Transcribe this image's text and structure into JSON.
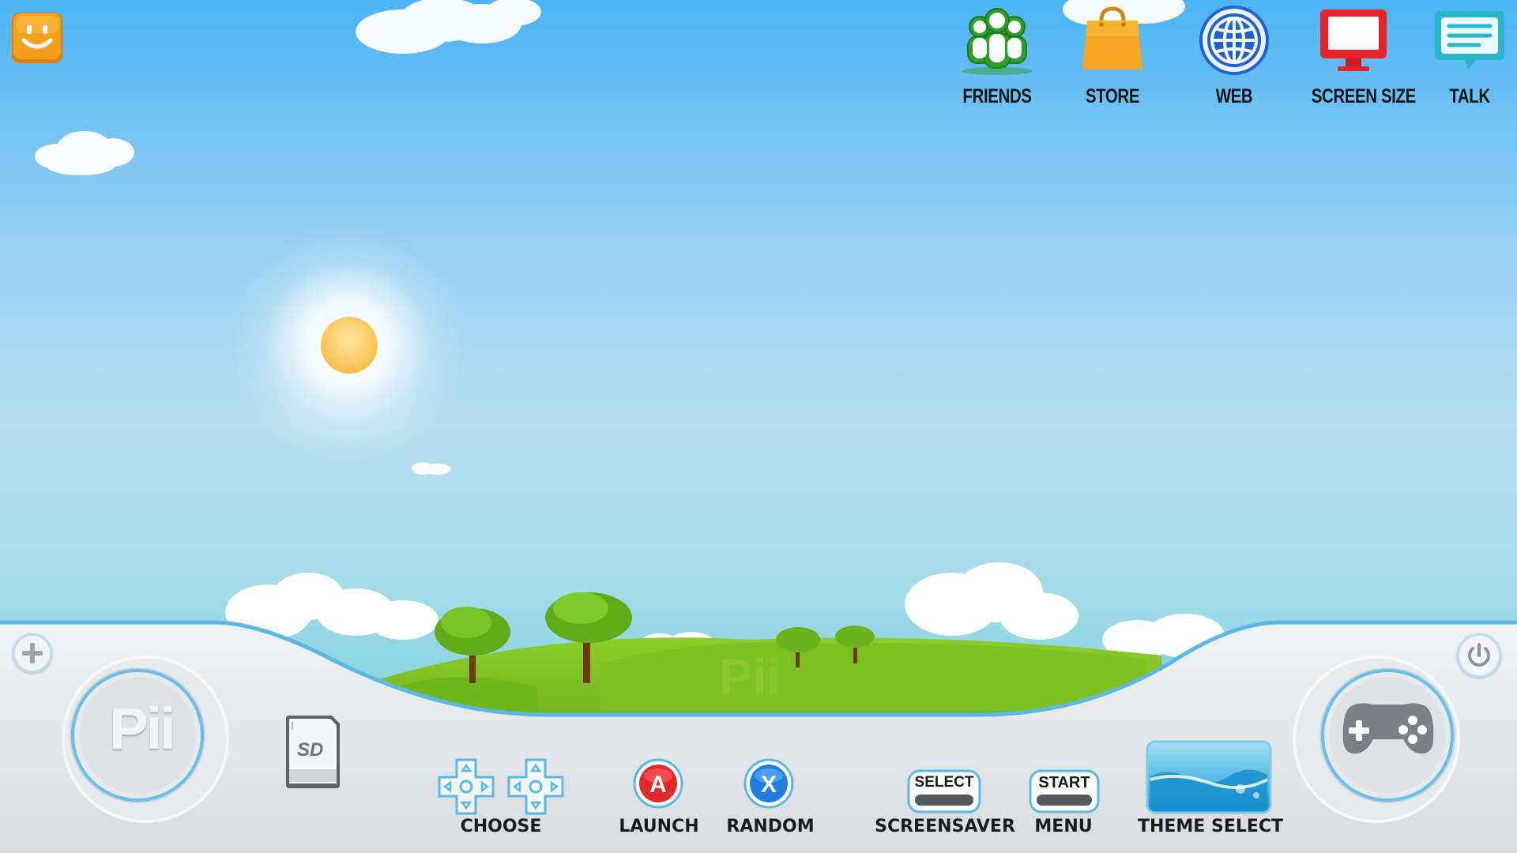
{
  "top_apps": [
    {
      "label": "FRIENDS",
      "icon": "friends-icon"
    },
    {
      "label": "STORE",
      "icon": "shopping-bag-icon"
    },
    {
      "label": "WEB",
      "icon": "globe-icon"
    },
    {
      "label": "SCREEN SIZE",
      "icon": "monitor-icon"
    },
    {
      "label": "TALK",
      "icon": "chat-bubble-icon"
    }
  ],
  "dock": {
    "logo_text": "Pii",
    "watermark_text": "Pii",
    "sd_card_text": "SD",
    "controls": [
      {
        "label": "CHOOSE",
        "glyph": "D-pad"
      },
      {
        "label": "LAUNCH",
        "glyph": "A"
      },
      {
        "label": "RANDOM",
        "glyph": "X"
      },
      {
        "label": "SCREENSAVER",
        "glyph": "SELECT"
      },
      {
        "label": "MENU",
        "glyph": "START"
      },
      {
        "label": "THEME SELECT",
        "glyph": "theme-preview"
      }
    ]
  },
  "colors": {
    "sky_top": "#4cb4f5",
    "accent_blue": "#5ab8e6",
    "launch_red": "#e02a2a",
    "random_blue": "#1f7fe0",
    "friends_green": "#37b52f",
    "store_orange": "#f5a623",
    "web_blue": "#1e63d6",
    "screen_red": "#e8232a",
    "talk_teal": "#29b6c8",
    "smiley_orange": "#f39a1e"
  }
}
